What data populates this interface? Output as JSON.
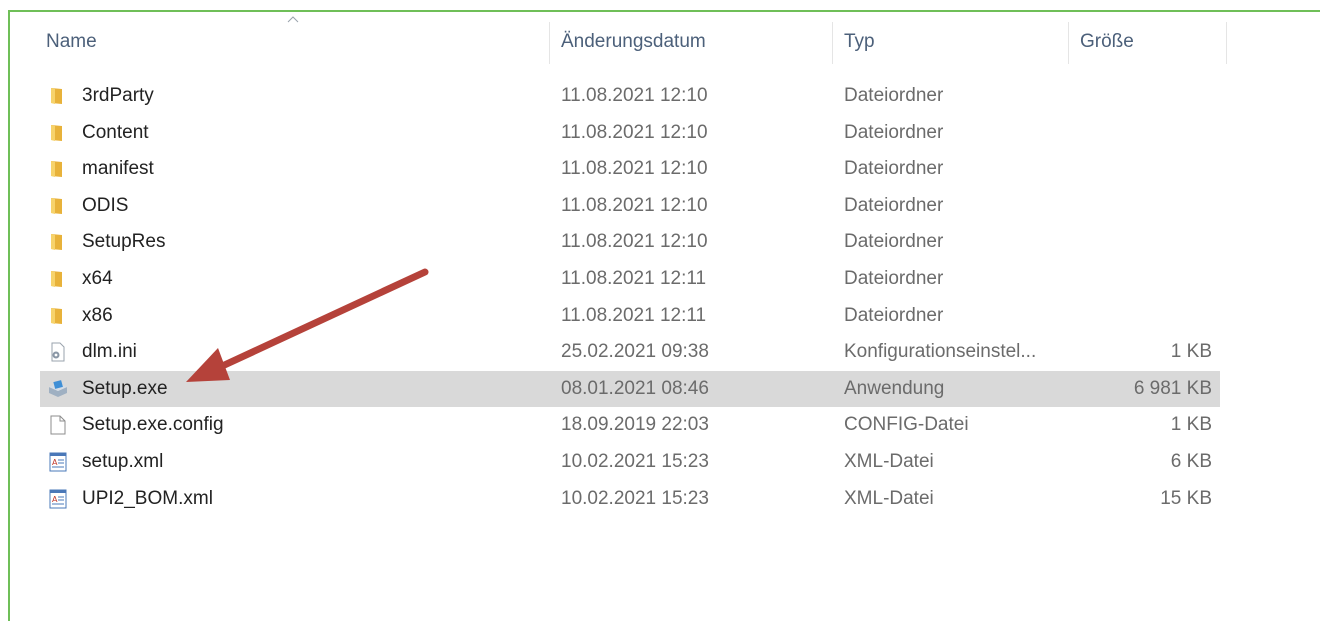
{
  "columns": {
    "name": "Name",
    "date": "Änderungsdatum",
    "type": "Typ",
    "size": "Größe"
  },
  "files": [
    {
      "name": "3rdParty",
      "date": "11.08.2021 12:10",
      "type": "Dateiordner",
      "size": "",
      "icon": "folder-icon"
    },
    {
      "name": "Content",
      "date": "11.08.2021 12:10",
      "type": "Dateiordner",
      "size": "",
      "icon": "folder-icon"
    },
    {
      "name": "manifest",
      "date": "11.08.2021 12:10",
      "type": "Dateiordner",
      "size": "",
      "icon": "folder-icon"
    },
    {
      "name": "ODIS",
      "date": "11.08.2021 12:10",
      "type": "Dateiordner",
      "size": "",
      "icon": "folder-icon"
    },
    {
      "name": "SetupRes",
      "date": "11.08.2021 12:10",
      "type": "Dateiordner",
      "size": "",
      "icon": "folder-icon"
    },
    {
      "name": "x64",
      "date": "11.08.2021 12:11",
      "type": "Dateiordner",
      "size": "",
      "icon": "folder-icon"
    },
    {
      "name": "x86",
      "date": "11.08.2021 12:11",
      "type": "Dateiordner",
      "size": "",
      "icon": "folder-icon"
    },
    {
      "name": "dlm.ini",
      "date": "25.02.2021 09:38",
      "type": "Konfigurationseinstel...",
      "size": "1 KB",
      "icon": "settings-file-icon"
    },
    {
      "name": "Setup.exe",
      "date": "08.01.2021 08:46",
      "type": "Anwendung",
      "size": "6 981 KB",
      "icon": "installer-icon",
      "selected": true
    },
    {
      "name": "Setup.exe.config",
      "date": "18.09.2019 22:03",
      "type": "CONFIG-Datei",
      "size": "1 KB",
      "icon": "blank-file-icon"
    },
    {
      "name": "setup.xml",
      "date": "10.02.2021 15:23",
      "type": "XML-Datei",
      "size": "6 KB",
      "icon": "xml-file-icon"
    },
    {
      "name": "UPI2_BOM.xml",
      "date": "10.02.2021 15:23",
      "type": "XML-Datei",
      "size": "15 KB",
      "icon": "xml-file-icon"
    }
  ],
  "colors": {
    "frame": "#6fbf58",
    "selection": "#d9d9d9",
    "arrow": "#b5423a",
    "folder": "#f2c14e"
  }
}
